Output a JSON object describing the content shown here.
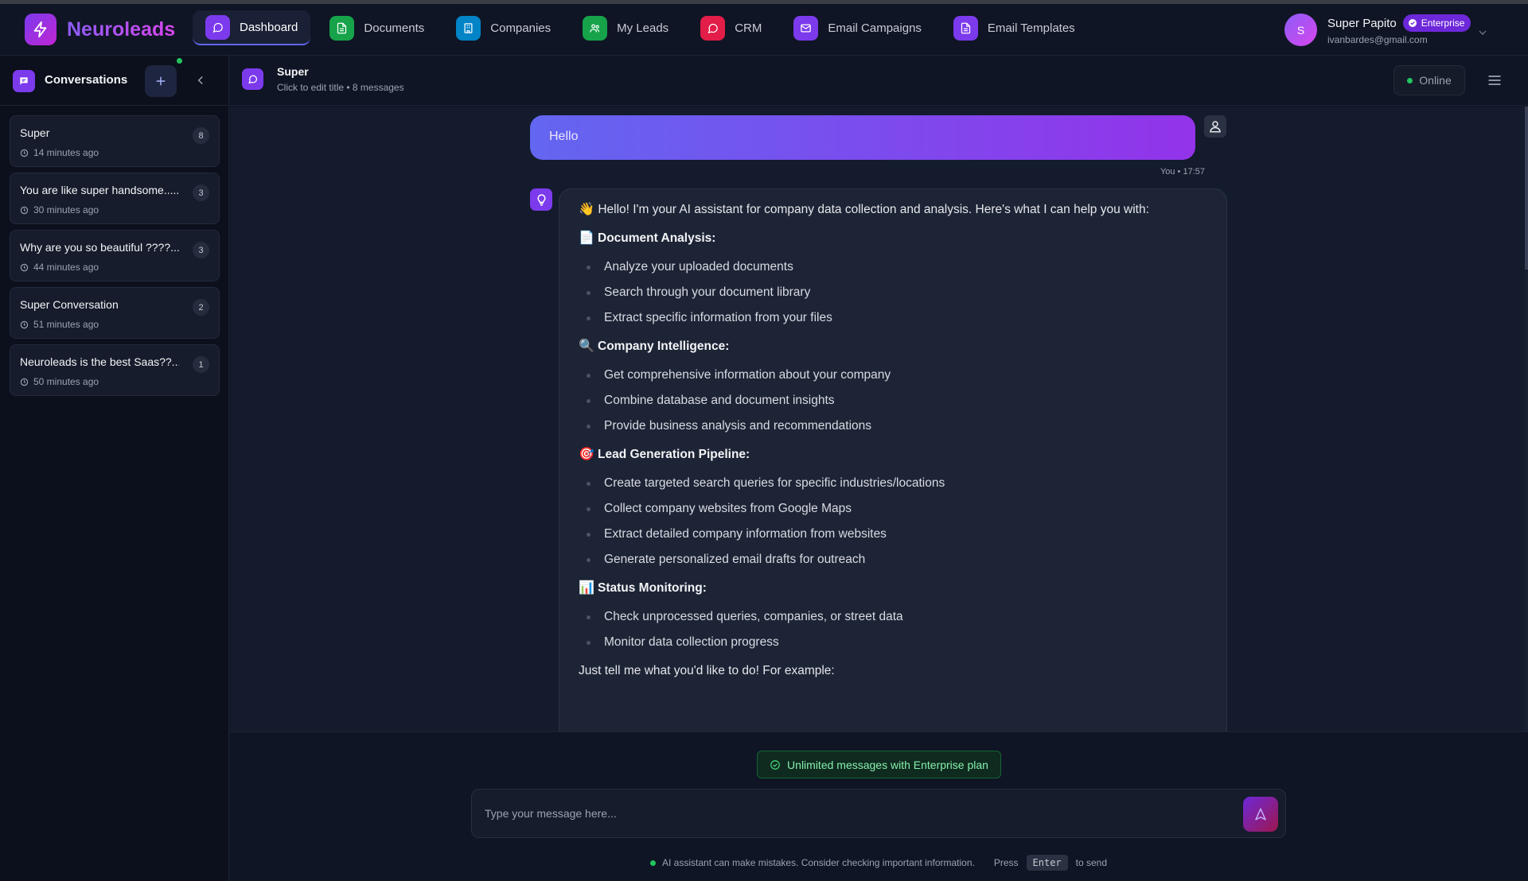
{
  "app": {
    "name": "Neuroleads",
    "brand_gradient": [
      "#7c3aed",
      "#d946ef"
    ]
  },
  "nav": {
    "items": [
      {
        "label": "Dashboard",
        "icon": "chat-icon",
        "color": "#7c3aed",
        "active": true
      },
      {
        "label": "Documents",
        "icon": "document-icon",
        "color": "#16a34a"
      },
      {
        "label": "Companies",
        "icon": "building-icon",
        "color": "#0284c7"
      },
      {
        "label": "My Leads",
        "icon": "users-icon",
        "color": "#16a34a"
      },
      {
        "label": "CRM",
        "icon": "chat-icon",
        "color": "#e11d48"
      },
      {
        "label": "Email Campaigns",
        "icon": "mail-icon",
        "color": "#7c3aed"
      },
      {
        "label": "Email Templates",
        "icon": "document-icon",
        "color": "#7c3aed"
      }
    ]
  },
  "user": {
    "initial": "S",
    "name": "Super Papito",
    "plan": "Enterprise",
    "email": "ivanbardes@gmail.com"
  },
  "sidebar": {
    "title": "Conversations",
    "conversations": [
      {
        "title": "Super",
        "time": "14 minutes ago",
        "count": "8"
      },
      {
        "title": "You are like super handsome......",
        "time": "30 minutes ago",
        "count": "3"
      },
      {
        "title": "Why are you so beautiful ????...",
        "time": "44 minutes ago",
        "count": "3"
      },
      {
        "title": "Super Conversation",
        "time": "51 minutes ago",
        "count": "2"
      },
      {
        "title": "Neuroleads is the best Saas??...",
        "time": "50 minutes ago",
        "count": "1"
      }
    ]
  },
  "chat": {
    "title": "Super",
    "subtitle": "Click to edit title • 8 messages",
    "status": "Online",
    "user_message": "Hello",
    "user_meta": "You • 17:57",
    "bot": {
      "intro": "Hello! I'm your AI assistant for company data collection and analysis. Here's what I can help you with:",
      "intro_emoji": "👋",
      "sections": [
        {
          "emoji": "📄",
          "heading": "Document Analysis:",
          "items": [
            "Analyze your uploaded documents",
            "Search through your document library",
            "Extract specific information from your files"
          ]
        },
        {
          "emoji": "🔍",
          "heading": "Company Intelligence:",
          "items": [
            "Get comprehensive information about your company",
            "Combine database and document insights",
            "Provide business analysis and recommendations"
          ]
        },
        {
          "emoji": "🎯",
          "heading": "Lead Generation Pipeline:",
          "items": [
            "Create targeted search queries for specific industries/locations",
            "Collect company websites from Google Maps",
            "Extract detailed company information from websites",
            "Generate personalized email drafts for outreach"
          ]
        },
        {
          "emoji": "📊",
          "heading": "Status Monitoring:",
          "items": [
            "Check unprocessed queries, companies, or street data",
            "Monitor data collection progress"
          ]
        }
      ],
      "outro": "Just tell me what you'd like to do! For example:"
    }
  },
  "composer": {
    "plan_notice": "Unlimited messages with Enterprise plan",
    "placeholder": "Type your message here...",
    "disclaimer": "AI assistant can make mistakes. Consider checking important information.",
    "press": "Press",
    "key": "Enter",
    "to_send": "to send"
  }
}
